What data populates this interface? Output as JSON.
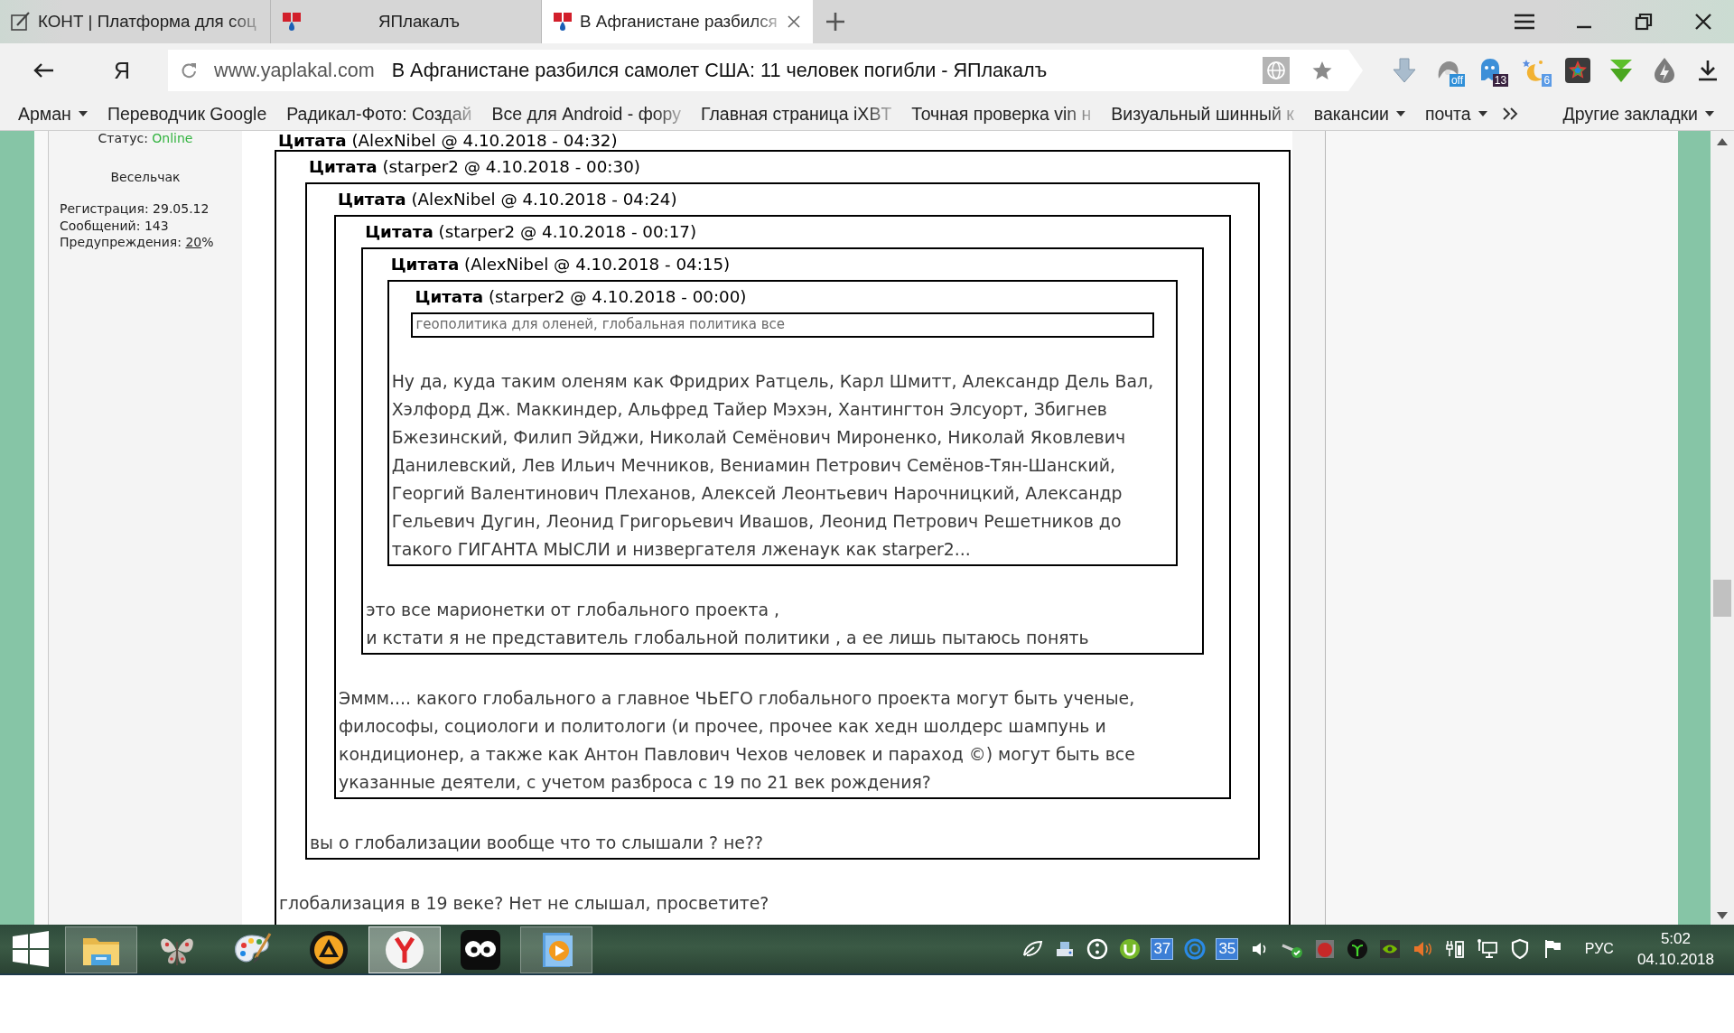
{
  "browser": {
    "tabs": [
      {
        "title": "КОНТ | Платформа для соц",
        "selected": false,
        "truncated": true
      },
      {
        "title": "ЯПлакалъ",
        "selected": false,
        "truncated": false
      },
      {
        "title": "В Афганистане разбился",
        "selected": true,
        "truncated": true
      }
    ],
    "logo_button": "Я",
    "address": {
      "domain": "www.yaplakal.com",
      "page_title": "В Афганистане разбился самолет США: 11 человек погибли - ЯПлакалъ"
    },
    "extension_badges": [
      "off",
      "13",
      "6"
    ],
    "bookmarks": [
      {
        "label": "Арман",
        "menu": true,
        "truncated": false
      },
      {
        "label": "Переводчик Google",
        "menu": false,
        "truncated": false
      },
      {
        "label": "Радикал-Фото: Создай",
        "menu": false,
        "truncated": true
      },
      {
        "label": "Все для Android - фору",
        "menu": false,
        "truncated": true
      },
      {
        "label": "Главная страница iXBT",
        "menu": false,
        "truncated": true
      },
      {
        "label": "Точная проверка vin н",
        "menu": false,
        "truncated": true
      },
      {
        "label": "Визуальный шинный к",
        "menu": false,
        "truncated": true
      },
      {
        "label": "вакансии",
        "menu": true,
        "truncated": false
      },
      {
        "label": "почта",
        "menu": true,
        "truncated": false
      }
    ],
    "other_bookmarks": {
      "label": "Другие закладки",
      "menu": true
    }
  },
  "profile": {
    "status_label": "Статус:",
    "status_value": "Online",
    "rank": "Весельчак",
    "stats": [
      {
        "label": "Регистрация:",
        "value": "29.05.12"
      },
      {
        "label": "Сообщений:",
        "value": "143"
      },
      {
        "label": "Предупреждения:",
        "link": "20",
        "suffix": "%"
      }
    ]
  },
  "post": {
    "quote": {
      "label": "Цитата",
      "source": "(AlexNibel @ 4.10.2018 - 04:32)",
      "kind": "regular",
      "text": "глобализация в 19 веке? Нет не слышал, просветите?",
      "quote": {
        "label": "Цитата",
        "source": "(starper2 @ 4.10.2018 - 00:30)",
        "kind": "regular",
        "text": "вы о глобализации вообще что то слышали ? не??",
        "quote": {
          "label": "Цитата",
          "source": "(AlexNibel @ 4.10.2018 - 04:24)",
          "kind": "regular",
          "text": "Эммм.... какого глобального а главное ЧЬЕГО глобального проекта могут быть ученые, философы, социологи и политологи (и прочее, прочее как хедн шолдерс шампунь и кондиционер, а также как Антон Павлович Чехов человек и параход ©) могут быть все указанные деятели, с учетом разброса с 19 по 21 век рождения?",
          "quote": {
            "label": "Цитата",
            "source": "(starper2 @ 4.10.2018 - 00:17)",
            "kind": "regular",
            "text": "это все марионетки от глобального проекта ,\nи кстати я не представитель глобальной политики , а ее лишь пытаюсь понять",
            "quote": {
              "label": "Цитата",
              "source": "(AlexNibel @ 4.10.2018 - 04:15)",
              "kind": "regular",
              "text": "Ну да, куда таким оленям как Фридрих Ратцель, Карл Шмитт, Александр Дель Вал, Хэлфорд Дж. Маккиндер, Альфред Тайер Мэхэн, Хантингтон Элсуорт, Збигнев Бжезинский, Филип Эйджи, Николай Семёнович Мироненко, Николай Яковлевич Данилевский, Лев Ильич Мечников, Вениамин Петрович Семёнов-Тян-Шанский, Георгий Валентинович Плеханов, Алексей Леонтьевич Нарочницкий, Александр Гельевич Дугин, Леонид Григорьевич Ивашов, Леонид Петрович Решетников до такого ГИГАНТА МЫСЛИ и низвергателя лженаук как starper2...",
              "quote": {
                "label": "Цитата",
                "source": "(starper2 @ 4.10.2018 - 00:00)",
                "kind": "compact",
                "text": "геополитика для оленей, глобальная политика все"
              }
            }
          }
        }
      }
    }
  },
  "taskbar": {
    "apps": [
      {
        "running": true,
        "selected": false
      },
      {
        "running": false,
        "selected": false
      },
      {
        "running": false,
        "selected": false
      },
      {
        "running": false,
        "selected": false
      },
      {
        "running": true,
        "selected": true
      },
      {
        "running": false,
        "selected": false
      },
      {
        "running": true,
        "selected": false
      }
    ],
    "tray_badges": [
      "37",
      "35"
    ],
    "language": "РУС",
    "time": "5:02",
    "date": "04.10.2018"
  }
}
